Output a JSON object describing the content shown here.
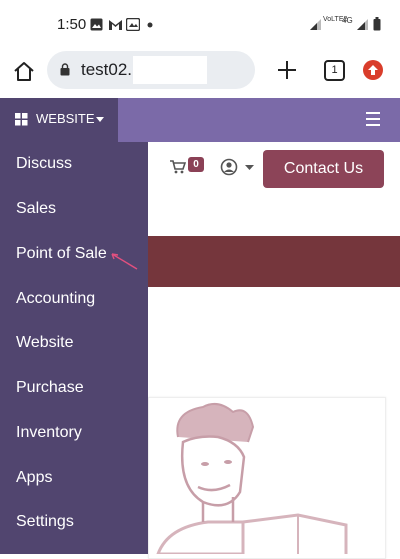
{
  "status_bar": {
    "time": "1:50",
    "icons": [
      "gallery-icon",
      "gmail-icon",
      "photos-icon",
      "dot-icon",
      "signal-icon",
      "volte-icon",
      "4g-icon",
      "signal-icon",
      "battery-icon"
    ],
    "network_label": "VoLTE2",
    "network_type": "4G"
  },
  "browser": {
    "url": "test02.",
    "tab_count": "1",
    "accent_update": "#d93d2b"
  },
  "odoo_bar": {
    "website_label": "WEBSITE",
    "bar_color": "#7b6aa8",
    "menu_color": "#51456f"
  },
  "header": {
    "cart_count": "0",
    "contact_label": "Contact Us",
    "contact_color": "#8c4458"
  },
  "sidebar": {
    "items": [
      {
        "label": "Discuss"
      },
      {
        "label": "Sales"
      },
      {
        "label": "Point of Sale"
      },
      {
        "label": "Accounting"
      },
      {
        "label": "Website"
      },
      {
        "label": "Purchase"
      },
      {
        "label": "Inventory"
      },
      {
        "label": "Apps"
      },
      {
        "label": "Settings"
      }
    ]
  }
}
